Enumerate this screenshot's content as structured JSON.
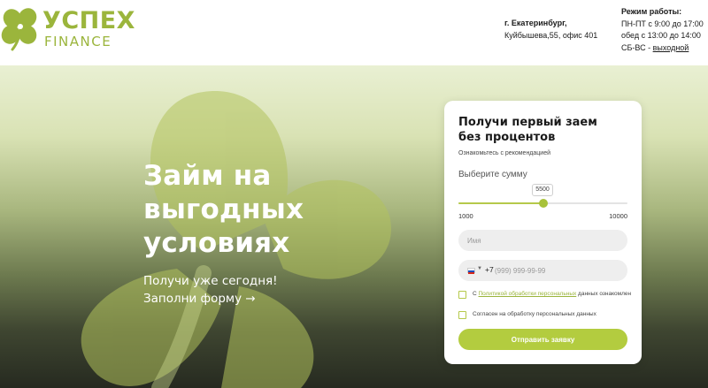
{
  "colors": {
    "brand_green": "#9bb53c",
    "button_green": "#b3cc3f",
    "slider_green": "#b5c94a",
    "text_dark": "#1a1a1a"
  },
  "header": {
    "logo": {
      "word": "УСПЕХ",
      "sub": "FINANCE",
      "icon": "clover-icon"
    },
    "address": {
      "city": "г. Екатеринбург,",
      "street": "Куйбышева,55, офис 401"
    },
    "hours": {
      "title": "Режим работы:",
      "weekdays": "ПН-ПТ с 9:00 до 17:00",
      "lunch": "обед с 13:00 до 14:00",
      "weekend_prefix": "СБ-ВС - ",
      "weekend_link": "выходной"
    }
  },
  "hero": {
    "title_lines": [
      "Займ на",
      "выгодных",
      "условиях"
    ],
    "subtitle": "Получи уже сегодня!",
    "cta": "Заполни форму →"
  },
  "form": {
    "title_lines": [
      "Получи первый заем",
      "без процентов"
    ],
    "recommendations": "Ознакомьтесь с рекомендацией",
    "amount_label": "Выберите сумму",
    "slider": {
      "min": 1000,
      "max": 10000,
      "value": 5500,
      "min_label": "1000",
      "max_label": "10000",
      "value_label": "5500"
    },
    "name_placeholder": "Имя",
    "phone": {
      "code": "+7",
      "placeholder": "(999) 999-99-99",
      "country_icon": "russia-flag-icon"
    },
    "consent_1": {
      "prefix": "С ",
      "link": "Политикой обработки персональных",
      "suffix": " данных ознакомлен"
    },
    "consent_2": "Согласен на обработку персональных данных",
    "submit_label": "Отправить заявку"
  }
}
